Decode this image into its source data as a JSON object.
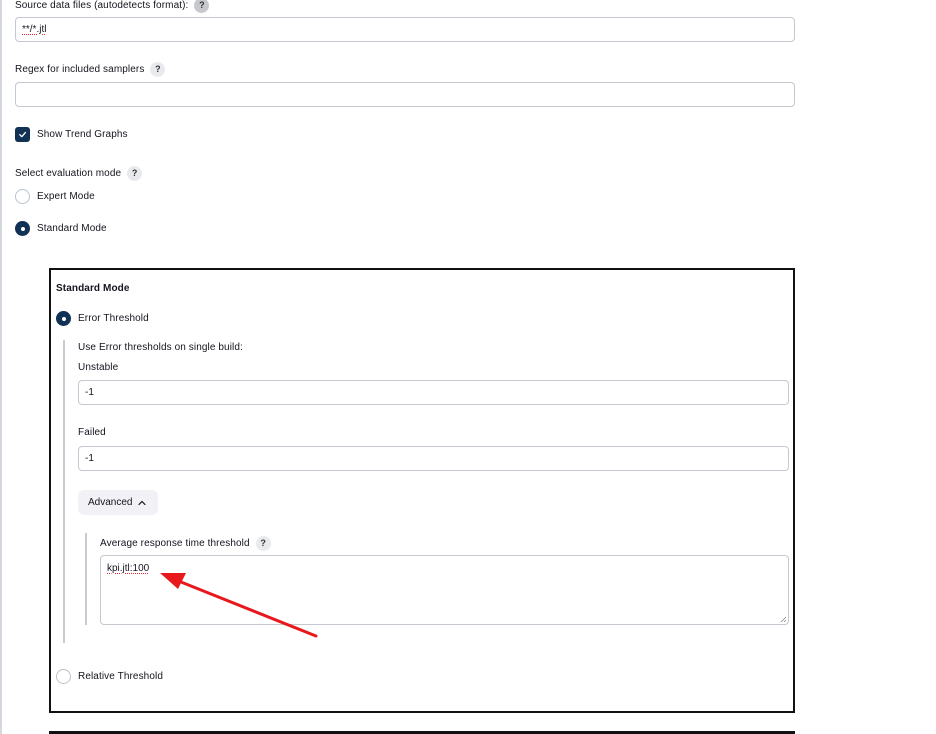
{
  "source_files": {
    "label": "Source data files (autodetects format):",
    "help": "?",
    "value": "**/*.jtl"
  },
  "regex_samplers": {
    "label": "Regex for included samplers",
    "help": "?",
    "value": ""
  },
  "show_trend_graphs": {
    "label": "Show Trend Graphs",
    "checked": true
  },
  "evaluation_mode": {
    "label": "Select evaluation mode",
    "help": "?",
    "options": [
      {
        "label": "Expert Mode",
        "selected": false
      },
      {
        "label": "Standard Mode",
        "selected": true
      }
    ]
  },
  "standard_mode_panel": {
    "title": "Standard Mode",
    "error_threshold": {
      "label": "Error Threshold",
      "selected": true,
      "description": "Use Error thresholds on single build:",
      "unstable_label": "Unstable",
      "unstable_value": "-1",
      "failed_label": "Failed",
      "failed_value": "-1"
    },
    "advanced": {
      "label": "Advanced",
      "chevron": "^",
      "expanded": true,
      "avg_response_label": "Average response time threshold",
      "help": "?",
      "avg_response_value": "kpi.jtl:100"
    },
    "relative_threshold": {
      "label": "Relative Threshold",
      "selected": false
    }
  },
  "annotation": {
    "type": "red-arrow",
    "color": "#e8191c",
    "points_to": "avg-response-time-textarea"
  },
  "colors": {
    "accent": "#113155",
    "input_border": "#c3c9cf",
    "panel_border": "#111111"
  }
}
